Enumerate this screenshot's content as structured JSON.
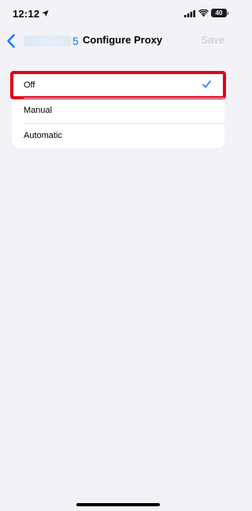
{
  "status": {
    "time": "12:12",
    "battery": "40",
    "location_icon": "location-arrow-icon",
    "signal_icon": "cellular-signal-icon",
    "wifi_icon": "wifi-icon"
  },
  "nav": {
    "back_label": "5",
    "title": "Configure Proxy",
    "save_label": "Save",
    "back_icon": "chevron-left-icon"
  },
  "options": [
    {
      "label": "Off",
      "selected": true
    },
    {
      "label": "Manual",
      "selected": false
    },
    {
      "label": "Automatic",
      "selected": false
    }
  ],
  "colors": {
    "background": "#f2f2f7",
    "accent": "#0a7aff",
    "highlight": "#e3001b",
    "disabled_text": "#c7c7cc"
  }
}
